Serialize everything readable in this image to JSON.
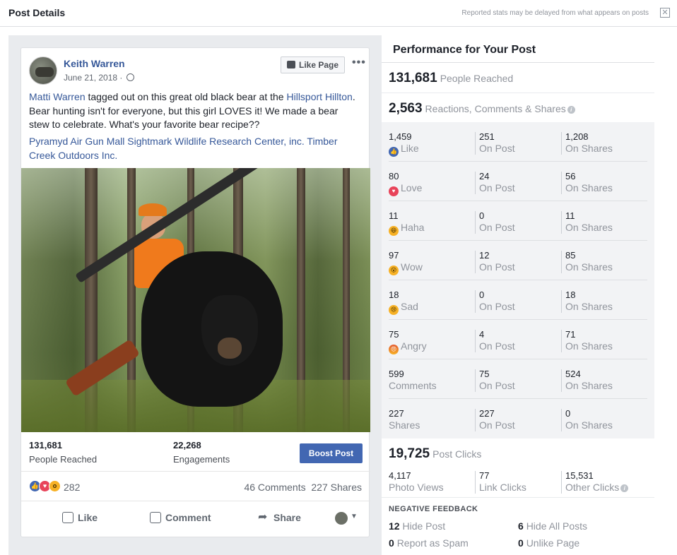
{
  "header": {
    "title": "Post Details",
    "note": "Reported stats may be delayed from what appears on posts"
  },
  "post": {
    "author": "Keith Warren",
    "date": "June 21, 2018 ·",
    "like_page_label": "Like Page",
    "text_link1": "Matti Warren",
    "text_part1": " tagged out on this great old black bear at the ",
    "text_link2": "Hillsport Hillton",
    "text_part2": ". Bear hunting isn't for everyone, but this girl LOVES it! We made a bear stew to celebrate. What's your favorite bear recipe??",
    "tagline": "Pyramyd Air Gun Mall Sightmark Wildlife Research Center, inc. Timber Creek Outdoors Inc.",
    "people_reached": "131,681",
    "people_reached_label": "People Reached",
    "engagements": "22,268",
    "engagements_label": "Engagements",
    "boost_label": "Boost Post",
    "reaction_count": "282",
    "comments": "46 Comments",
    "shares": "227 Shares",
    "action_like": "Like",
    "action_comment": "Comment",
    "action_share": "Share"
  },
  "performance": {
    "title": "Performance for Your Post",
    "reached_num": "131,681",
    "reached_label": "People Reached",
    "rcs_num": "2,563",
    "rcs_label": "Reactions, Comments & Shares",
    "rows": [
      {
        "total": "1,459",
        "label": "Like",
        "emoji": "like",
        "on_post": "251",
        "on_shares": "1,208"
      },
      {
        "total": "80",
        "label": "Love",
        "emoji": "love",
        "on_post": "24",
        "on_shares": "56"
      },
      {
        "total": "11",
        "label": "Haha",
        "emoji": "haha",
        "on_post": "0",
        "on_shares": "11"
      },
      {
        "total": "97",
        "label": "Wow",
        "emoji": "wow",
        "on_post": "12",
        "on_shares": "85"
      },
      {
        "total": "18",
        "label": "Sad",
        "emoji": "sad",
        "on_post": "0",
        "on_shares": "18"
      },
      {
        "total": "75",
        "label": "Angry",
        "emoji": "angry",
        "on_post": "4",
        "on_shares": "71"
      },
      {
        "total": "599",
        "label": "Comments",
        "emoji": "",
        "on_post": "75",
        "on_shares": "524"
      },
      {
        "total": "227",
        "label": "Shares",
        "emoji": "",
        "on_post": "227",
        "on_shares": "0"
      }
    ],
    "on_post_label": "On Post",
    "on_shares_label": "On Shares",
    "clicks_num": "19,725",
    "clicks_label": "Post Clicks",
    "photo_views": "4,117",
    "photo_views_label": "Photo Views",
    "link_clicks": "77",
    "link_clicks_label": "Link Clicks",
    "other_clicks": "15,531",
    "other_clicks_label": "Other Clicks",
    "negative_title": "NEGATIVE FEEDBACK",
    "hide_post_num": "12",
    "hide_post_label": "Hide Post",
    "hide_all_num": "6",
    "hide_all_label": "Hide All Posts",
    "spam_num": "0",
    "spam_label": "Report as Spam",
    "unlike_num": "0",
    "unlike_label": "Unlike Page"
  },
  "colors": {
    "accent": "#4267b2",
    "link": "#365899",
    "muted": "#90949c"
  }
}
